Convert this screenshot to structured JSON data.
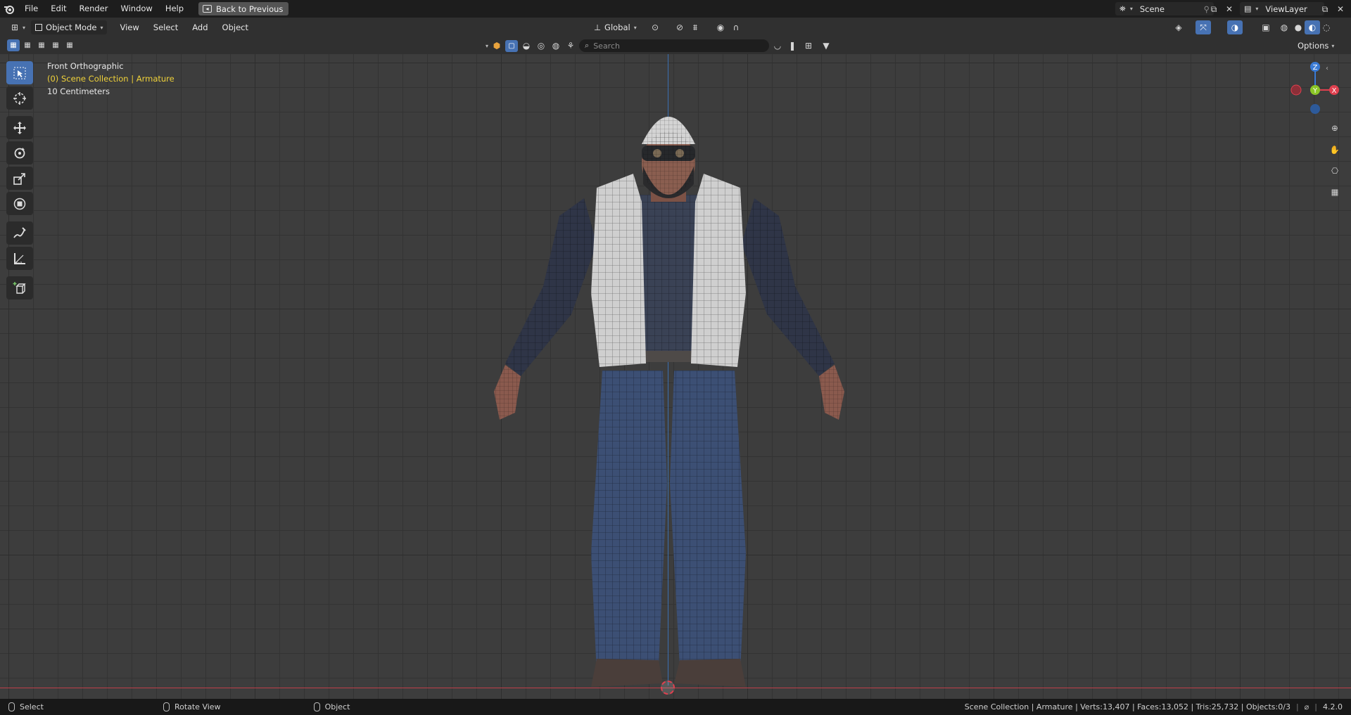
{
  "menubar": {
    "items": [
      {
        "label": "File"
      },
      {
        "label": "Edit"
      },
      {
        "label": "Render"
      },
      {
        "label": "Window"
      },
      {
        "label": "Help"
      }
    ],
    "back_button": "Back to Previous",
    "scene": "Scene",
    "view_layer": "ViewLayer"
  },
  "header": {
    "mode": "Object Mode",
    "menus": [
      {
        "label": "View"
      },
      {
        "label": "Select"
      },
      {
        "label": "Add"
      },
      {
        "label": "Object"
      }
    ],
    "orientation": "Global"
  },
  "subheader": {
    "search_placeholder": "Search",
    "options": "Options"
  },
  "viewport": {
    "view_name": "Front Orthographic",
    "collection_path": "(0) Scene Collection | Armature",
    "scale": "10 Centimeters",
    "gizmo_axes": {
      "z": "Z",
      "y": "Y",
      "x": "X"
    }
  },
  "statusbar": {
    "select": "Select",
    "rotate": "Rotate View",
    "object": "Object",
    "stats": "Scene Collection | Armature | Verts:13,407 | Faces:13,052 | Tris:25,732 | Objects:0/3",
    "version": "4.2.0"
  },
  "colors": {
    "accent": "#4772b3",
    "x_axis": "#e0404f",
    "y_axis": "#8bc727",
    "z_axis": "#3a7bd5",
    "active_text": "#f0d23a"
  }
}
